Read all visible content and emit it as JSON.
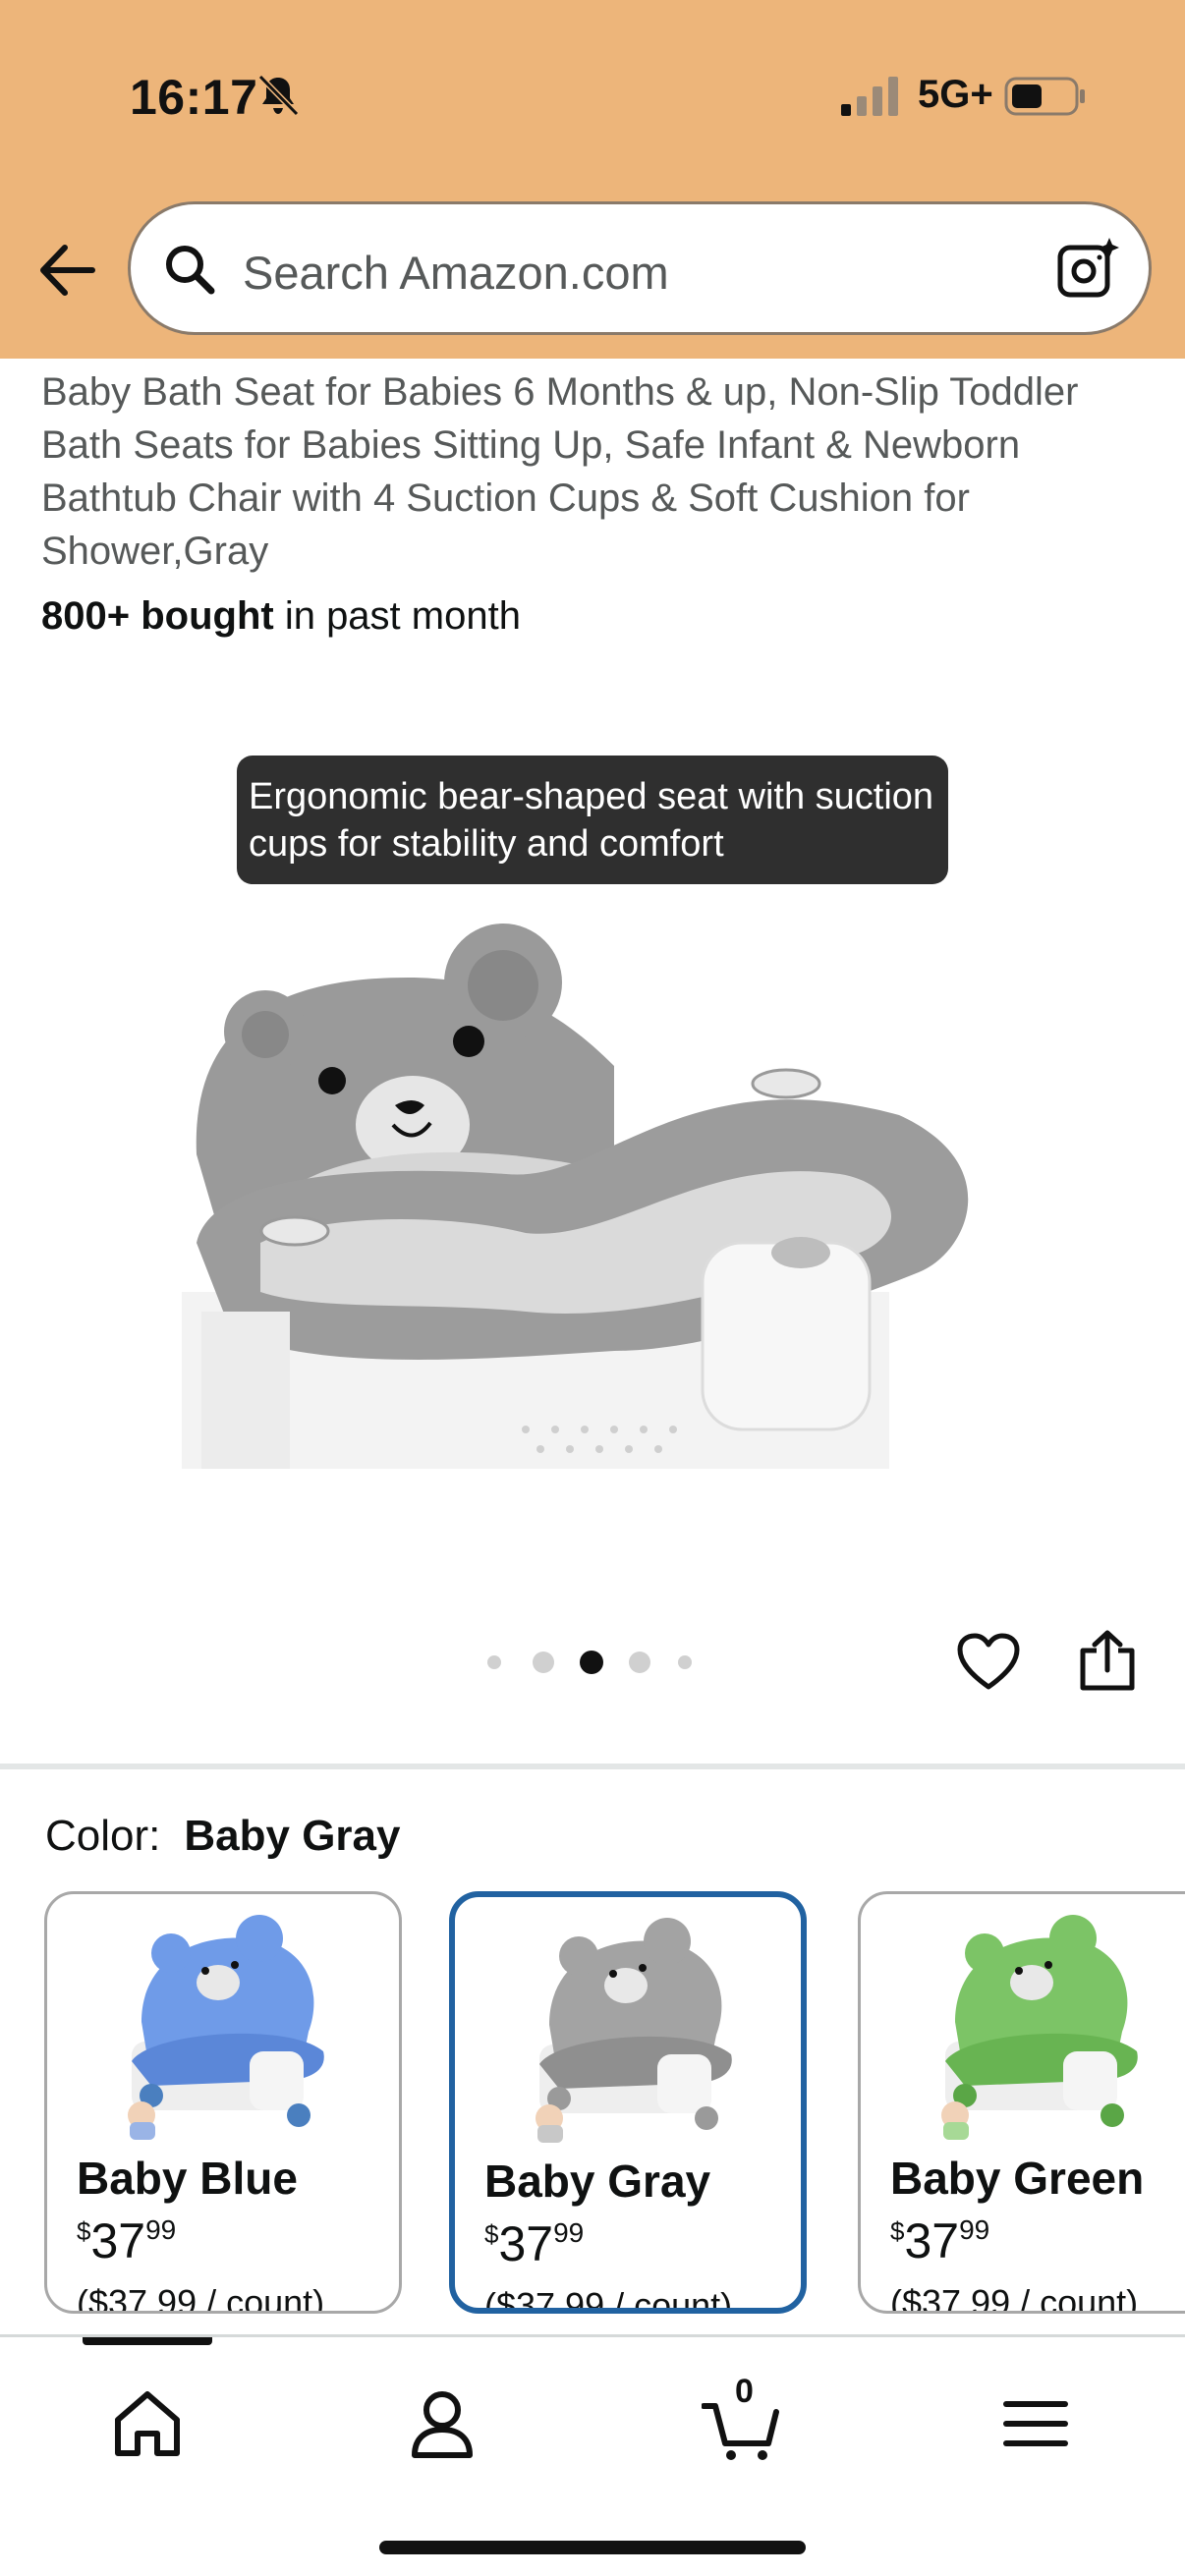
{
  "status": {
    "time": "16:17",
    "network": "5G+"
  },
  "search": {
    "placeholder": "Search Amazon.com"
  },
  "product": {
    "title": "Baby Bath Seat for Babies 6 Months & up, Non-Slip Toddler Bath Seats for Babies Sitting Up, Safe Infant & Newborn Bathtub Chair with 4 Suction Cups & Soft Cushion for Shower,Gray",
    "bought_bold": "800+ bought",
    "bought_rest": " in past month",
    "tooltip": "Ergonomic bear-shaped seat with suction cups for stability and comfort",
    "carousel": {
      "count": 5,
      "active_index": 2
    }
  },
  "color": {
    "label": "Color:",
    "selected": "Baby Gray",
    "options": [
      {
        "name": "Baby Blue",
        "currency": "$",
        "dollars": "37",
        "cents": "99",
        "unit": "($37.99 / count)",
        "tint": "#6f9be8",
        "selected": false
      },
      {
        "name": "Baby Gray",
        "currency": "$",
        "dollars": "37",
        "cents": "99",
        "unit": "($37.99 / count)",
        "tint": "#a3a3a3",
        "selected": true
      },
      {
        "name": "Baby Green",
        "currency": "$",
        "dollars": "37",
        "cents": "99",
        "unit": "($37.99 / count)",
        "tint": "#7cc466",
        "selected": false
      }
    ]
  },
  "nav": {
    "cart_count": "0"
  },
  "colors": {
    "header_bg": "#edb57a",
    "selected_border": "#2162a1",
    "tooltip_bg": "#2f2f2f"
  },
  "icons": [
    "back-arrow-icon",
    "search-icon",
    "camera-lens-icon",
    "heart-icon",
    "share-icon",
    "home-icon",
    "account-icon",
    "cart-icon",
    "menu-icon"
  ]
}
